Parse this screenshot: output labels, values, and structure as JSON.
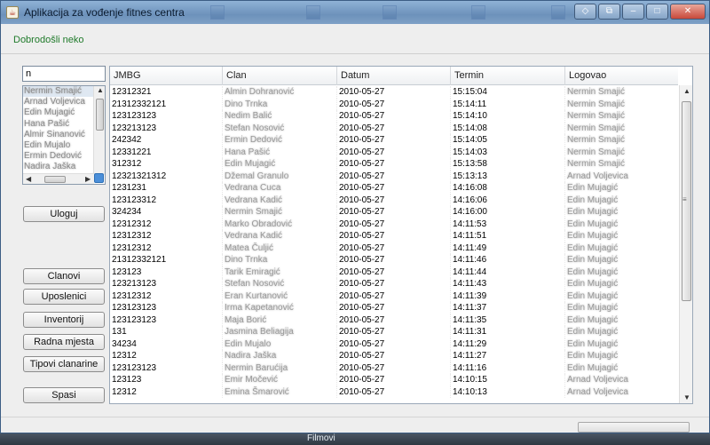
{
  "window": {
    "title": "Aplikacija za vođenje fitnes centra",
    "controls": [
      "◇",
      "⧉",
      "–",
      "□",
      "✕"
    ]
  },
  "greeting": "Dobrodošli neko",
  "search": {
    "value": "n"
  },
  "name_list": [
    "Nermin Smajić",
    "Arnad Voljevica",
    "Edin Mujagić",
    "Hana Pašić",
    "Almir Sinanović",
    "Edin Mujalo",
    "Ermin Dedović",
    "Nadira Jaška"
  ],
  "buttons": {
    "login": "Uloguj",
    "members": "Clanovi",
    "employees": "Uposlenici",
    "inventory": "Inventorij",
    "workplaces": "Radna mjesta",
    "membership_types": "Tipovi clanarine",
    "save": "Spasi"
  },
  "table": {
    "columns": [
      "JMBG",
      "Clan",
      "Datum",
      "Termin",
      "Logovao"
    ],
    "rows": [
      [
        "12312321",
        "Almin Dohranović",
        "2010-05-27",
        "15:15:04",
        "Nermin Smajić"
      ],
      [
        "21312332121",
        "Dino Trnka",
        "2010-05-27",
        "15:14:11",
        "Nermin Smajić"
      ],
      [
        "123123123",
        "Nedim Balić",
        "2010-05-27",
        "15:14:10",
        "Nermin Smajić"
      ],
      [
        "123213123",
        "Stefan Nosović",
        "2010-05-27",
        "15:14:08",
        "Nermin Smajić"
      ],
      [
        "242342",
        "Ermin Dedović",
        "2010-05-27",
        "15:14:05",
        "Nermin Smajić"
      ],
      [
        "12331221",
        "Hana Pašić",
        "2010-05-27",
        "15:14:03",
        "Nermin Smajić"
      ],
      [
        "312312",
        "Edin Mujagić",
        "2010-05-27",
        "15:13:58",
        "Nermin Smajić"
      ],
      [
        "12321321312",
        "Džemal Granulo",
        "2010-05-27",
        "15:13:13",
        "Arnad Voljevica"
      ],
      [
        "1231231",
        "Vedrana Cuca",
        "2010-05-27",
        "14:16:08",
        "Edin Mujagić"
      ],
      [
        "123123312",
        "Vedrana Kadić",
        "2010-05-27",
        "14:16:06",
        "Edin Mujagić"
      ],
      [
        "324234",
        "Nermin Smajić",
        "2010-05-27",
        "14:16:00",
        "Edin Mujagić"
      ],
      [
        "12312312",
        "Marko Obradović",
        "2010-05-27",
        "14:11:53",
        "Edin Mujagić"
      ],
      [
        "12312312",
        "Vedrana Kadić",
        "2010-05-27",
        "14:11:51",
        "Edin Mujagić"
      ],
      [
        "12312312",
        "Matea Čuljić",
        "2010-05-27",
        "14:11:49",
        "Edin Mujagić"
      ],
      [
        "21312332121",
        "Dino Trnka",
        "2010-05-27",
        "14:11:46",
        "Edin Mujagić"
      ],
      [
        "123123",
        "Tarik Emiragić",
        "2010-05-27",
        "14:11:44",
        "Edin Mujagić"
      ],
      [
        "123213123",
        "Stefan Nosović",
        "2010-05-27",
        "14:11:43",
        "Edin Mujagić"
      ],
      [
        "12312312",
        "Eran Kurtanović",
        "2010-05-27",
        "14:11:39",
        "Edin Mujagić"
      ],
      [
        "123123123",
        "Irma Kapetanović",
        "2010-05-27",
        "14:11:37",
        "Edin Mujagić"
      ],
      [
        "123123123",
        "Maja Borić",
        "2010-05-27",
        "14:11:35",
        "Edin Mujagić"
      ],
      [
        "131",
        "Jasmina Beliagija",
        "2010-05-27",
        "14:11:31",
        "Edin Mujagić"
      ],
      [
        "34234",
        "Edin Mujalo",
        "2010-05-27",
        "14:11:29",
        "Edin Mujagić"
      ],
      [
        "12312",
        "Nadira Jaška",
        "2010-05-27",
        "14:11:27",
        "Edin Mujagić"
      ],
      [
        "123123123",
        "Nermin Barućija",
        "2010-05-27",
        "14:11:16",
        "Edin Mujagić"
      ],
      [
        "123123",
        "Emir Močević",
        "2010-05-27",
        "14:10:15",
        "Arnad Voljevica"
      ],
      [
        "12312",
        "Emina Šmarović",
        "2010-05-27",
        "14:10:13",
        "Arnad Voljevica"
      ]
    ]
  },
  "taskbar": {
    "right_label": "Filmovi"
  }
}
